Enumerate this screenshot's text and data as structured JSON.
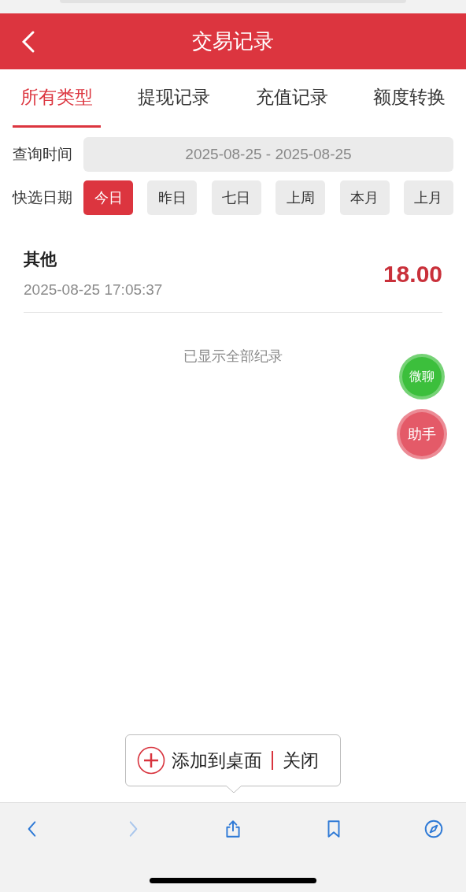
{
  "header": {
    "title": "交易记录"
  },
  "tabs": [
    {
      "label": "所有类型",
      "selected": true
    },
    {
      "label": "提现记录",
      "selected": false
    },
    {
      "label": "充值记录",
      "selected": false
    },
    {
      "label": "额度转换",
      "selected": false
    }
  ],
  "query": {
    "label": "查询时间",
    "value": "2025-08-25 - 2025-08-25"
  },
  "quick_dates": {
    "label": "快选日期",
    "options": [
      {
        "label": "今日",
        "selected": true
      },
      {
        "label": "昨日",
        "selected": false
      },
      {
        "label": "七日",
        "selected": false
      },
      {
        "label": "上周",
        "selected": false
      },
      {
        "label": "本月",
        "selected": false
      },
      {
        "label": "上月",
        "selected": false
      }
    ]
  },
  "records": [
    {
      "type": "其他",
      "time": "2025-08-25 17:05:37",
      "amount": "18.00"
    }
  ],
  "end_message": "已显示全部纪录",
  "floating_buttons": [
    {
      "label": "微聊",
      "color": "#3cbf3c"
    },
    {
      "label": "助手",
      "color": "#e45a68"
    }
  ],
  "add_to_home_popup": {
    "action": "添加到桌面",
    "close": "关闭"
  },
  "browser_toolbar": [
    {
      "kind": "back",
      "disabled": false
    },
    {
      "kind": "forward",
      "disabled": true
    },
    {
      "kind": "share",
      "disabled": false
    },
    {
      "kind": "bookmarks",
      "disabled": false
    },
    {
      "kind": "compass",
      "disabled": false
    }
  ]
}
